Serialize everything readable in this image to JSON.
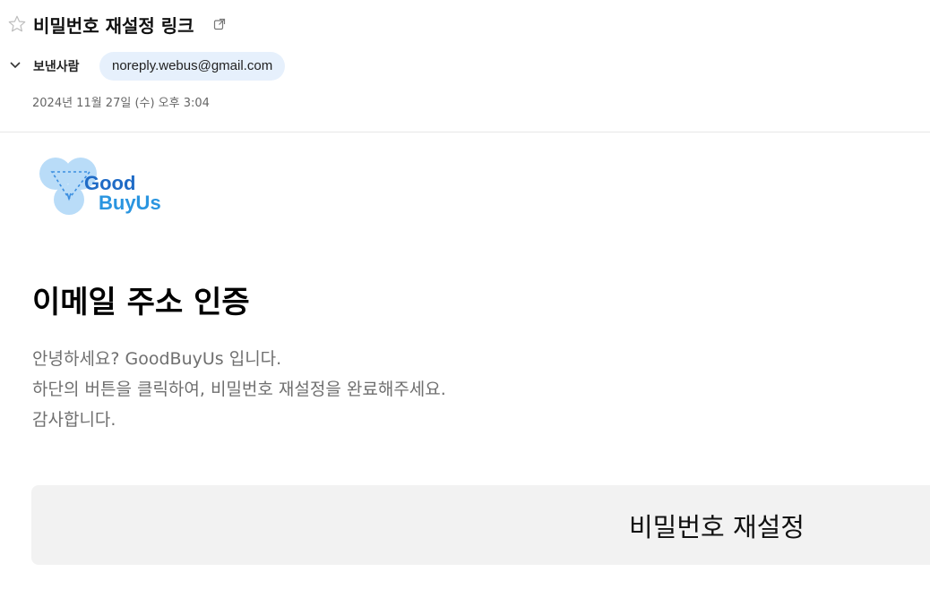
{
  "email": {
    "subject": "비밀번호 재설정 링크",
    "sender_label": "보낸사람",
    "sender_email": "noreply.webus@gmail.com",
    "date": "2024년 11월 27일 (수) 오후 3:04"
  },
  "content": {
    "logo": {
      "line1": "Good",
      "line2": "BuyUs"
    },
    "heading": "이메일 주소 인증",
    "paragraphs": [
      "안녕하세요? GoodBuyUs 입니다.",
      "하단의 버튼을 클릭하여, 비밀번호 재설정을 완료해주세요.",
      "감사합니다."
    ],
    "button_label": "비밀번호 재설정"
  },
  "icons": {
    "star": "star-icon",
    "external": "external-link-icon",
    "chevron": "chevron-down-icon"
  },
  "colors": {
    "chip_bg": "#e6f0fc",
    "logo_dark_blue": "#1f6bc6",
    "logo_light_blue": "#2a95e0",
    "button_bg": "#f2f2f2"
  }
}
